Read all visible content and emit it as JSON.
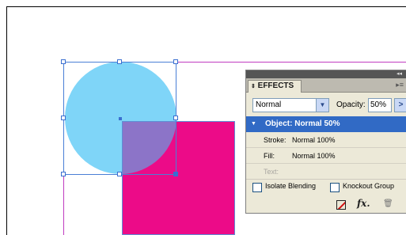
{
  "panel": {
    "tab_label": "EFFECTS",
    "collapse_glyph": "◂◂",
    "menu_glyph": "▸≡",
    "blend_mode": "Normal",
    "opacity_label": "Opacity:",
    "opacity_value": "50%",
    "rows": {
      "object": "Object: Normal 50%",
      "stroke_name": "Stroke:",
      "stroke_value": "Normal 100%",
      "fill_name": "Fill:",
      "fill_value": "Normal 100%",
      "text_name": "Text:"
    },
    "isolate_blending": "Isolate Blending",
    "knockout_group": "Knockout Group"
  },
  "icons": {
    "clear_effects": "clear-effects-icon",
    "fx": "fx-icon",
    "trash": "trash-icon"
  },
  "colors": {
    "circle": "#7fd5f8",
    "square": "#ec0b88",
    "overlap": "#8c74c8",
    "selection": "#4a7fd6",
    "guide": "#c03cc0",
    "panel_selected_row": "#316ac5"
  }
}
